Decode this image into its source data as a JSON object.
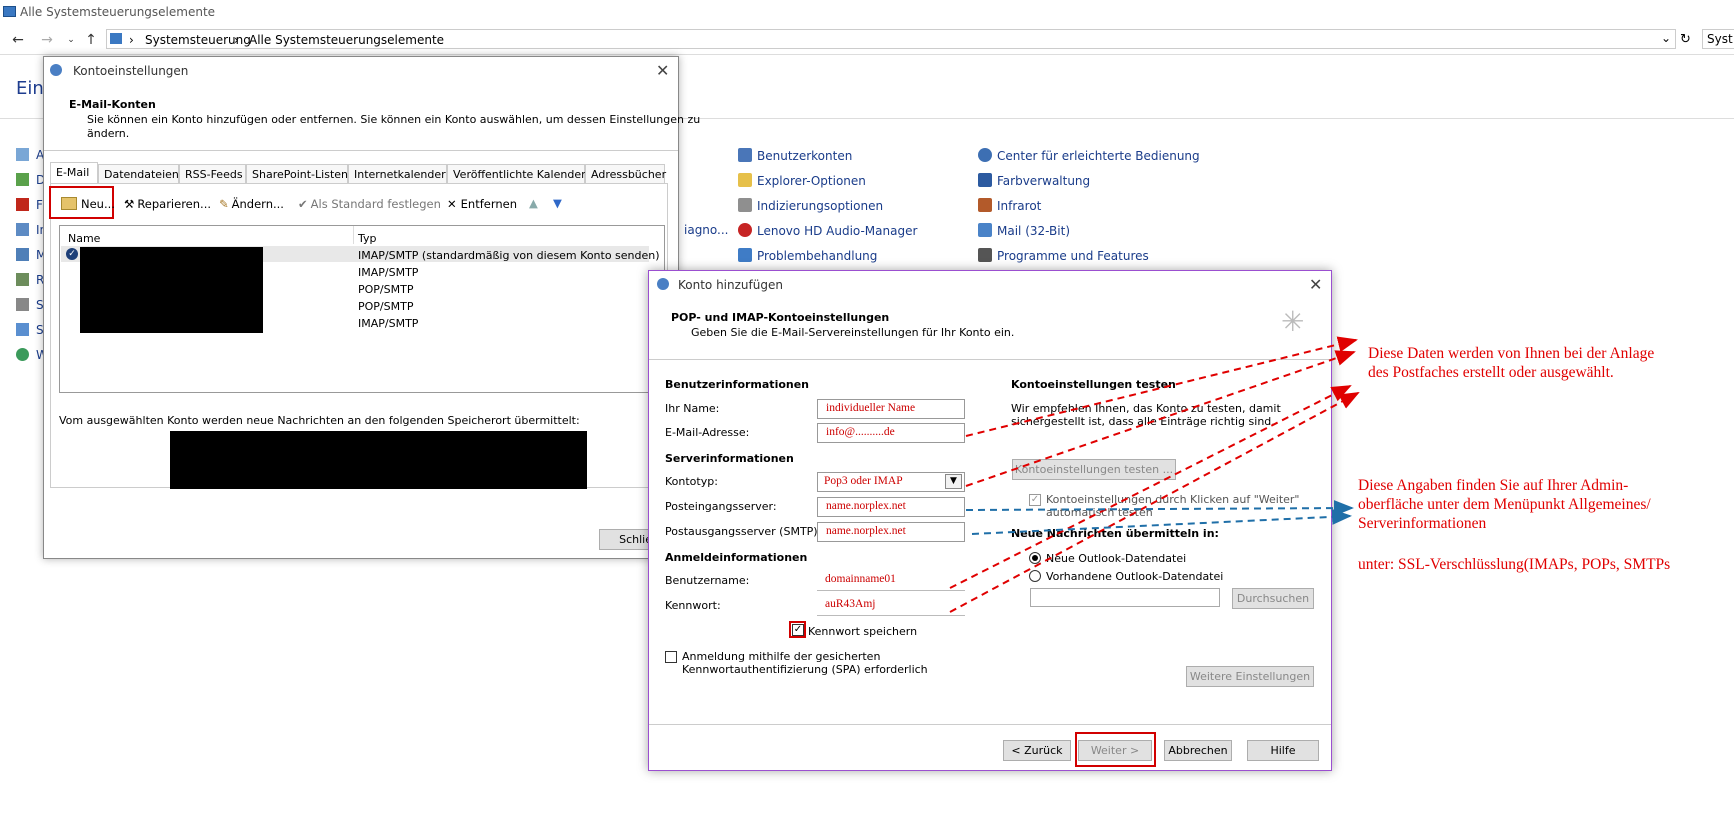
{
  "explorer": {
    "title": "Alle Systemsteuerungselemente",
    "breadcrumb": [
      "Systemsteuerung",
      "Alle Systemsteuerungselemente"
    ],
    "search": "Syst",
    "heading": "Eins",
    "left_letters": [
      "A",
      "D",
      "F",
      "In",
      "M",
      "R",
      "S",
      "S",
      "W"
    ],
    "diag_fragment": "iagno...",
    "col1": [
      "Benutzerkonten",
      "Explorer-Optionen",
      "Indizierungsoptionen",
      "Lenovo HD Audio-Manager",
      "Problembehandlung"
    ],
    "col2": [
      "Center für erleichterte Bedienung",
      "Farbverwaltung",
      "Infrarot",
      "Mail (32-Bit)",
      "Programme und Features"
    ]
  },
  "konto": {
    "title": "Kontoeinstellungen",
    "header_title": "E-Mail-Konten",
    "header_desc_1": "Sie können ein Konto hinzufügen oder entfernen. Sie können ein Konto auswählen, um dessen Einstellungen zu",
    "header_desc_2": "ändern.",
    "tabs": [
      "E-Mail",
      "Datendateien",
      "RSS-Feeds",
      "SharePoint-Listen",
      "Internetkalender",
      "Veröffentlichte Kalender",
      "Adressbücher"
    ],
    "toolbar": {
      "new": "Neu...",
      "repair": "Reparieren...",
      "change": "Ändern...",
      "default": "Als Standard festlegen",
      "remove": "Entfernen"
    },
    "columns": [
      "Name",
      "Typ"
    ],
    "rows": [
      "IMAP/SMTP (standardmäßig von diesem Konto senden)",
      "IMAP/SMTP",
      "POP/SMTP",
      "POP/SMTP",
      "IMAP/SMTP"
    ],
    "delivery_text": "Vom ausgewählten Konto werden neue Nachrichten an den folgenden Speicherort übermittelt:",
    "close_btn": "Schließ"
  },
  "add": {
    "title": "Konto hinzufügen",
    "header_title": "POP- und IMAP-Kontoeinstellungen",
    "header_desc": "Geben Sie die E-Mail-Servereinstellungen für Ihr Konto ein.",
    "user_section": "Benutzerinformationen",
    "name_label": "Ihr Name:",
    "name_value": "individueller Name",
    "email_label": "E-Mail-Adresse:",
    "email_value": "info@..........de",
    "server_section": "Serverinformationen",
    "type_label": "Kontotyp:",
    "type_value": "Pop3 oder IMAP",
    "in_label": "Posteingangsserver:",
    "in_value": "name.norplex.net",
    "out_label": "Postausgangsserver (SMTP):",
    "out_value": "name.norplex.net",
    "login_section": "Anmeldeinformationen",
    "user_label": "Benutzername:",
    "user_value": "domainname01",
    "pw_label": "Kennwort:",
    "pw_value": "auR43Amj",
    "save_pw": "Kennwort speichern",
    "spa_1": "Anmeldung mithilfe der gesicherten",
    "spa_2": "Kennwortauthentifizierung (SPA) erforderlich",
    "test_section": "Kontoeinstellungen testen",
    "test_desc_1": "Wir empfehlen Ihnen, das Konto zu testen, damit",
    "test_desc_2": "sichergestellt ist, dass alle Einträge richtig sind.",
    "test_btn": "Kontoeinstellungen testen ...",
    "auto_test_1": "Kontoeinstellungen durch Klicken auf \"Weiter\"",
    "auto_test_2": "automatisch testen",
    "deliver_section": "Neue Nachrichten übermitteln in:",
    "new_file": "Neue Outlook-Datendatei",
    "existing_file": "Vorhandene Outlook-Datendatei",
    "browse": "Durchsuchen",
    "more": "Weitere Einstellungen",
    "back": "< Zurück",
    "next": "Weiter >",
    "cancel": "Abbrechen",
    "help": "Hilfe"
  },
  "annotations": {
    "a1_1": "Diese Daten werden von Ihnen bei der Anlage",
    "a1_2": "des Postfaches erstellt oder ausgewählt.",
    "a2_1": "Diese Angaben finden Sie auf Ihrer Admin-",
    "a2_2": "oberfläche unter dem Menüpunkt Allgemeines/",
    "a2_3": "Serverinformationen",
    "a2_4": "unter: SSL-Verschlüsslung(IMAPs, POPs, SMTPs"
  },
  "colors": {
    "accent_link": "#1a3c8a",
    "annotation_red": "#e00000",
    "annotation_blue": "#1f6fa8",
    "add_border": "#9b4fd0"
  }
}
